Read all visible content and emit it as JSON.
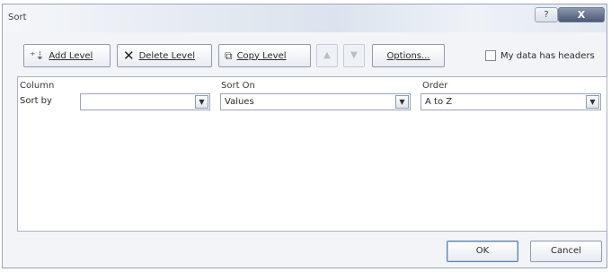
{
  "window": {
    "title": "Sort",
    "help_label": "?",
    "close_label": "X"
  },
  "toolbar": {
    "add_level": "Add Level",
    "delete_level": "Delete Level",
    "copy_level": "Copy Level",
    "move_up": "▲",
    "move_down": "▼",
    "options": "Options...",
    "my_data_has_headers": "My data has headers",
    "my_data_has_headers_checked": false
  },
  "columns": {
    "column": "Column",
    "sort_on": "Sort On",
    "order": "Order"
  },
  "rows": [
    {
      "label": "Sort by",
      "column_value": "",
      "sort_on_value": "Values",
      "order_value": "A to Z"
    }
  ],
  "footer": {
    "ok": "OK",
    "cancel": "Cancel"
  },
  "icons": {
    "add_level": "add-level-icon",
    "delete_level": "delete-x-icon",
    "copy_level": "copy-icon",
    "dropdown": "chevron-down-icon"
  },
  "colors": {
    "close_button": "#4b5a78",
    "dialog_bg": "#f2f4f7",
    "border": "#9aa6b8"
  }
}
